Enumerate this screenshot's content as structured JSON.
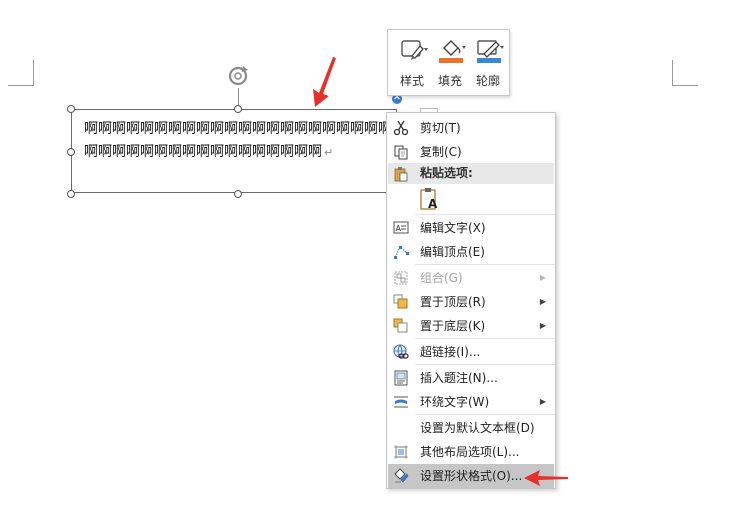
{
  "mini_toolbar": {
    "style_label": "样式",
    "fill_label": "填充",
    "outline_label": "轮廓",
    "fill_color": "#e8732a",
    "outline_color": "#3a86d9"
  },
  "text_box": {
    "content": "啊啊啊啊啊啊啊啊啊啊啊啊啊啊啊啊啊啊啊啊啊啊啊啊啊啊啊啊啊啊啊啊啊啊啊啊啊啊啊",
    "paragraph_mark": "↵"
  },
  "context_menu": {
    "cut": "剪切(T)",
    "copy": "复制(C)",
    "paste_options": "粘贴选项:",
    "edit_text": "编辑文字(X)",
    "edit_points": "编辑顶点(E)",
    "group": "组合(G)",
    "bring_to_front": "置于顶层(R)",
    "send_to_back": "置于底层(K)",
    "hyperlink": "超链接(I)...",
    "insert_caption": "插入题注(N)...",
    "wrap_text": "环绕文字(W)",
    "set_default_textbox": "设置为默认文本框(D)",
    "more_layout_options": "其他布局选项(L)...",
    "format_shape": "设置形状格式(O)..."
  },
  "icons": {
    "cut": "scissors-icon",
    "copy": "copy-icon",
    "paste": "clipboard-icon",
    "edit_text": "edit-text-icon",
    "edit_points": "edit-points-icon",
    "group": "group-icon",
    "bring_to_front": "bring-front-icon",
    "send_to_back": "send-back-icon",
    "hyperlink": "hyperlink-icon",
    "insert_caption": "caption-icon",
    "wrap_text": "wrap-text-icon",
    "more_layout": "layout-icon",
    "format_shape": "format-shape-icon"
  },
  "annotation_color": "#e8302a"
}
